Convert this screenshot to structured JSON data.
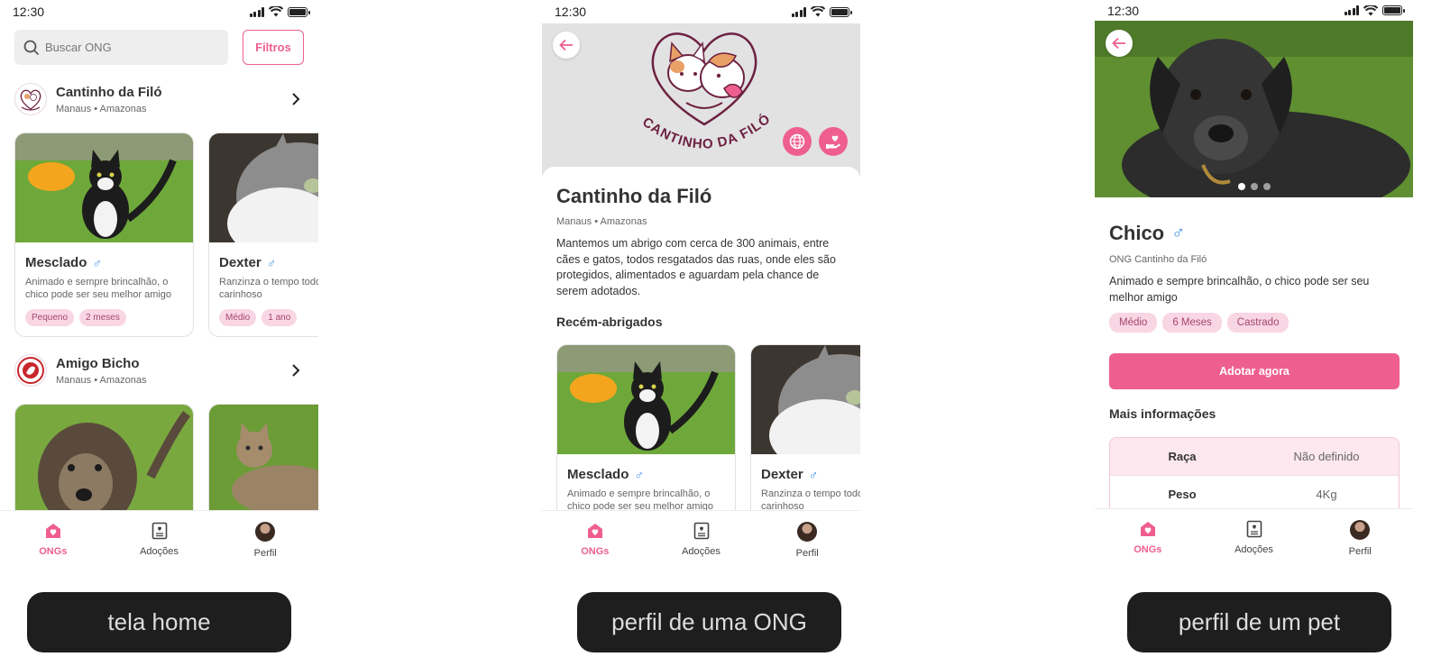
{
  "status_time": "12:30",
  "home": {
    "search_placeholder": "Buscar ONG",
    "filters_label": "Filtros",
    "ongs": [
      {
        "name": "Cantinho da Filó",
        "city": "Manaus",
        "state": "Amazonas",
        "pets": [
          {
            "name": "Mesclado",
            "desc_line1": "Animado e sempre brincalhão, o",
            "desc_line2": "chico pode ser seu melhor amigo",
            "tags": [
              "Pequeno",
              "2 meses"
            ]
          },
          {
            "name": "Dexter",
            "desc_line1": "Ranzinza o tempo todo",
            "desc_line2": "carinhoso",
            "tags": [
              "Médio",
              "1 ano"
            ]
          }
        ]
      },
      {
        "name": "Amigo Bicho",
        "city": "Manaus",
        "state": "Amazonas"
      }
    ]
  },
  "nav": {
    "ongs": "ONGs",
    "adocoes": "Adoções",
    "perfil": "Perfil"
  },
  "ong_profile": {
    "name": "Cantinho da Filó",
    "city": "Manaus",
    "state": "Amazonas",
    "description_lines": [
      "Mantemos um abrigo com cerca de 300 animais, entre",
      "cães e gatos, todos resgatados das ruas, onde eles são",
      "protegidos, alimentados e aguardam pela chance de",
      "serem adotados."
    ],
    "section_title": "Recém-abrigados",
    "logo_text": "CANTINHO DA FILÓ",
    "pets": [
      {
        "name": "Mesclado",
        "desc_line1": "Animado e sempre brincalhão, o",
        "desc_line2": "chico pode ser seu melhor amigo"
      },
      {
        "name": "Dexter",
        "desc_line1": "Ranzinza o tempo todo",
        "desc_line2": "carinhoso"
      }
    ]
  },
  "pet_profile": {
    "name": "Chico",
    "ong": "ONG Cantinho da Filó",
    "desc_line1": "Animado e sempre brincalhão, o chico pode ser seu",
    "desc_line2": "melhor amigo",
    "tags": [
      "Médio",
      "6 Meses",
      "Castrado"
    ],
    "adopt_label": "Adotar agora",
    "more_info_title": "Mais informações",
    "info": [
      {
        "key": "Raça",
        "value": "Não definido"
      },
      {
        "key": "Peso",
        "value": "4Kg"
      }
    ],
    "carousel_active": 1,
    "carousel_count": 3
  },
  "captions": {
    "home": "tela home",
    "ong": "perfil de uma ONG",
    "pet": "perfil de um pet"
  },
  "colors": {
    "accent": "#ee5f90",
    "tag_bg": "#f9d6e3",
    "male": "#3d8ee6",
    "caption_bg": "#1e1e1e"
  }
}
